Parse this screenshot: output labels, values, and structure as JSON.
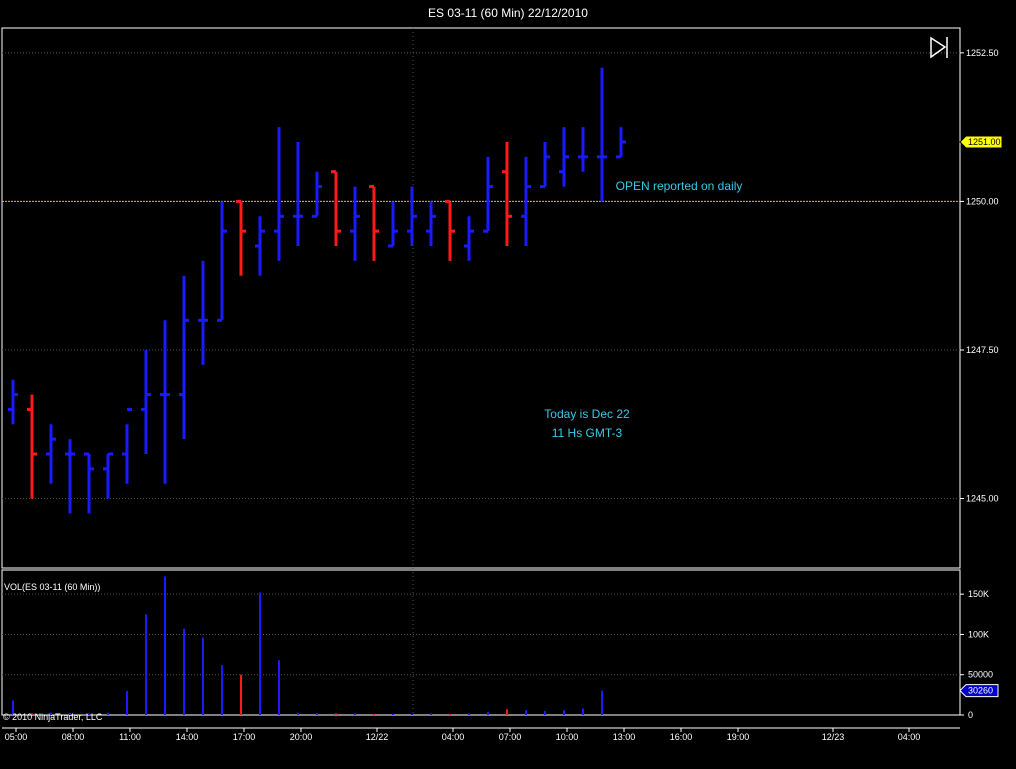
{
  "window": {
    "title": "ES 03-11 (60 Min)  22/12/2010"
  },
  "price_panel": {
    "y_ticks": [
      "1252.50",
      "1250.00",
      "1247.50",
      "1245.00"
    ],
    "last_price": "1251.00",
    "reference_line_value": 1250.0,
    "annotations": {
      "open": "OPEN reported on daily",
      "today_line1": "Today is Dec 22",
      "today_line2": "11 Hs GMT-3"
    }
  },
  "volume_panel": {
    "label": "VOL(ES 03-11 (60 Min))",
    "y_ticks": [
      "150K",
      "100K",
      "50000",
      "0"
    ],
    "last_volume": "30260"
  },
  "x_axis": {
    "ticks": [
      "05:00",
      "08:00",
      "11:00",
      "14:00",
      "17:00",
      "20:00",
      "12/22",
      "04:00",
      "07:00",
      "10:00",
      "13:00",
      "16:00",
      "19:00",
      "12/23",
      "04:00"
    ]
  },
  "copyright": "© 2010 NinjaTrader, LLC",
  "colors": {
    "up": "#1a1aff",
    "down": "#ff1a1a",
    "grid": "#555555",
    "ref_line": "#c8c800",
    "annotation": "#3cc8e6",
    "last_price_bg": "#ffff00"
  },
  "icons": {
    "scroll_end": "scroll-to-end-icon"
  },
  "chart_data": {
    "type": "ohlc",
    "title": "ES 03-11 (60 Min)  22/12/2010",
    "ylim": [
      1244.0,
      1252.75
    ],
    "bars": [
      {
        "open": 1246.5,
        "high": 1247.0,
        "low": 1246.25,
        "close": 1246.75,
        "dir": "up"
      },
      {
        "open": 1246.5,
        "high": 1246.75,
        "low": 1245.0,
        "close": 1245.75,
        "dir": "down"
      },
      {
        "open": 1245.75,
        "high": 1246.25,
        "low": 1245.25,
        "close": 1246.0,
        "dir": "up"
      },
      {
        "open": 1245.75,
        "high": 1246.0,
        "low": 1244.75,
        "close": 1245.75,
        "dir": "up"
      },
      {
        "open": 1245.75,
        "high": 1245.75,
        "low": 1244.75,
        "close": 1245.5,
        "dir": "up"
      },
      {
        "open": 1245.5,
        "high": 1245.75,
        "low": 1245.0,
        "close": 1245.75,
        "dir": "up"
      },
      {
        "open": 1245.75,
        "high": 1246.25,
        "low": 1245.25,
        "close": 1246.5,
        "dir": "up"
      },
      {
        "open": 1246.5,
        "high": 1247.5,
        "low": 1245.75,
        "close": 1246.75,
        "dir": "up"
      },
      {
        "open": 1246.75,
        "high": 1248.0,
        "low": 1245.25,
        "close": 1246.75,
        "dir": "up"
      },
      {
        "open": 1246.75,
        "high": 1248.75,
        "low": 1246.0,
        "close": 1248.0,
        "dir": "up"
      },
      {
        "open": 1248.0,
        "high": 1249.0,
        "low": 1247.25,
        "close": 1248.0,
        "dir": "up"
      },
      {
        "open": 1248.0,
        "high": 1250.0,
        "low": 1248.0,
        "close": 1249.5,
        "dir": "up"
      },
      {
        "open": 1250.0,
        "high": 1250.0,
        "low": 1248.75,
        "close": 1249.5,
        "dir": "down"
      },
      {
        "open": 1249.25,
        "high": 1249.75,
        "low": 1248.75,
        "close": 1249.5,
        "dir": "up"
      },
      {
        "open": 1249.5,
        "high": 1251.25,
        "low": 1249.0,
        "close": 1249.75,
        "dir": "up"
      },
      {
        "open": 1249.75,
        "high": 1251.0,
        "low": 1249.25,
        "close": 1249.75,
        "dir": "up"
      },
      {
        "open": 1249.75,
        "high": 1250.5,
        "low": 1249.75,
        "close": 1250.25,
        "dir": "up"
      },
      {
        "open": 1250.5,
        "high": 1250.5,
        "low": 1249.25,
        "close": 1249.5,
        "dir": "down"
      },
      {
        "open": 1249.5,
        "high": 1250.25,
        "low": 1249.0,
        "close": 1249.75,
        "dir": "up"
      },
      {
        "open": 1250.25,
        "high": 1250.25,
        "low": 1249.0,
        "close": 1249.5,
        "dir": "down"
      },
      {
        "open": 1249.25,
        "high": 1250.0,
        "low": 1249.25,
        "close": 1249.5,
        "dir": "up"
      },
      {
        "open": 1249.5,
        "high": 1250.25,
        "low": 1249.25,
        "close": 1249.75,
        "dir": "up"
      },
      {
        "open": 1249.5,
        "high": 1250.0,
        "low": 1249.25,
        "close": 1249.75,
        "dir": "up"
      },
      {
        "open": 1250.0,
        "high": 1250.0,
        "low": 1249.0,
        "close": 1249.5,
        "dir": "down"
      },
      {
        "open": 1249.25,
        "high": 1249.75,
        "low": 1249.0,
        "close": 1249.5,
        "dir": "up"
      },
      {
        "open": 1249.5,
        "high": 1250.75,
        "low": 1249.5,
        "close": 1250.25,
        "dir": "up"
      },
      {
        "open": 1250.5,
        "high": 1251.0,
        "low": 1249.25,
        "close": 1249.75,
        "dir": "down"
      },
      {
        "open": 1249.75,
        "high": 1250.75,
        "low": 1249.25,
        "close": 1250.25,
        "dir": "up"
      },
      {
        "open": 1250.25,
        "high": 1251.0,
        "low": 1250.25,
        "close": 1250.75,
        "dir": "up"
      },
      {
        "open": 1250.5,
        "high": 1251.25,
        "low": 1250.25,
        "close": 1250.75,
        "dir": "up"
      },
      {
        "open": 1250.75,
        "high": 1251.25,
        "low": 1250.5,
        "close": 1250.75,
        "dir": "up"
      },
      {
        "open": 1250.75,
        "high": 1252.25,
        "low": 1250.0,
        "close": 1250.75,
        "dir": "up"
      },
      {
        "open": 1250.75,
        "high": 1251.25,
        "low": 1250.75,
        "close": 1251.0,
        "dir": "up"
      }
    ],
    "volume": {
      "ylim": [
        0,
        180000
      ],
      "values": [
        18000,
        2000,
        3000,
        2500,
        2000,
        3000,
        30000,
        125000,
        172000,
        107000,
        96000,
        62000,
        50000,
        152000,
        68000,
        3000,
        2500,
        2000,
        2000,
        1500,
        1500,
        1500,
        2000,
        1500,
        2000,
        4000,
        7000,
        6000,
        5000,
        6000,
        8000,
        30260,
        0
      ],
      "dir": [
        "up",
        "down",
        "up",
        "up",
        "up",
        "up",
        "up",
        "up",
        "up",
        "up",
        "up",
        "up",
        "down",
        "up",
        "up",
        "up",
        "up",
        "down",
        "up",
        "down",
        "up",
        "up",
        "up",
        "down",
        "up",
        "up",
        "down",
        "up",
        "up",
        "up",
        "up",
        "up",
        "up"
      ]
    }
  }
}
